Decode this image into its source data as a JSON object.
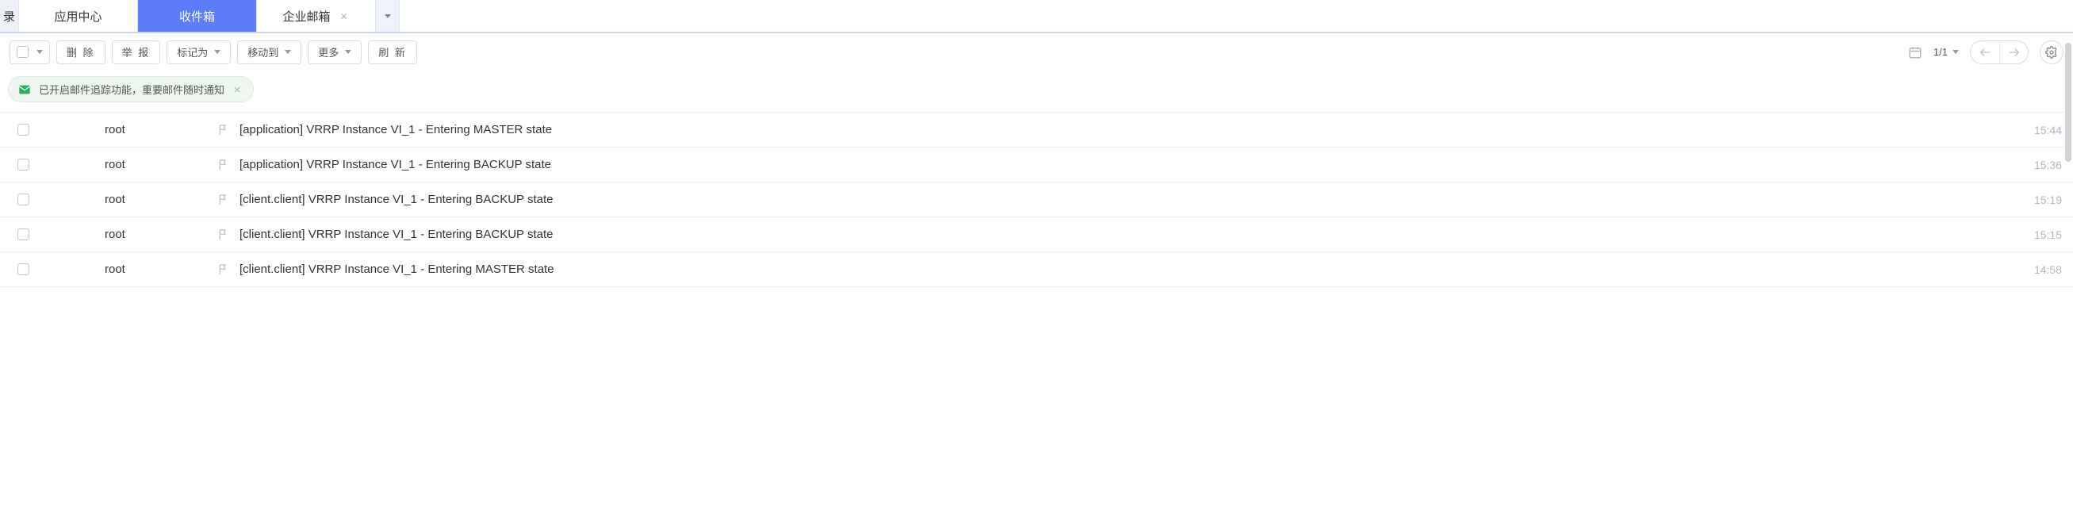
{
  "tabs": {
    "frag": "录",
    "items": [
      {
        "label": "应用中心",
        "active": false,
        "closable": false
      },
      {
        "label": "收件箱",
        "active": true,
        "closable": false
      },
      {
        "label": "企业邮箱",
        "active": false,
        "closable": true
      }
    ]
  },
  "toolbar": {
    "delete_label": "删 除",
    "report_label": "举 报",
    "markas_label": "标记为",
    "moveto_label": "移动到",
    "more_label": "更多",
    "refresh_label": "刷 新",
    "page_text": "1/1"
  },
  "notice": {
    "text": "已开启邮件追踪功能，重要邮件随时通知"
  },
  "mails": [
    {
      "sender": "root",
      "subject": "[application] VRRP Instance VI_1 - Entering MASTER state",
      "time": "15:44"
    },
    {
      "sender": "root",
      "subject": "[application] VRRP Instance VI_1 - Entering BACKUP state",
      "time": "15:36"
    },
    {
      "sender": "root",
      "subject": "[client.client] VRRP Instance VI_1 - Entering BACKUP state",
      "time": "15:19"
    },
    {
      "sender": "root",
      "subject": "[client.client] VRRP Instance VI_1 - Entering BACKUP state",
      "time": "15:15"
    },
    {
      "sender": "root",
      "subject": "[client.client] VRRP Instance VI_1 - Entering MASTER state",
      "time": "14:58"
    }
  ]
}
